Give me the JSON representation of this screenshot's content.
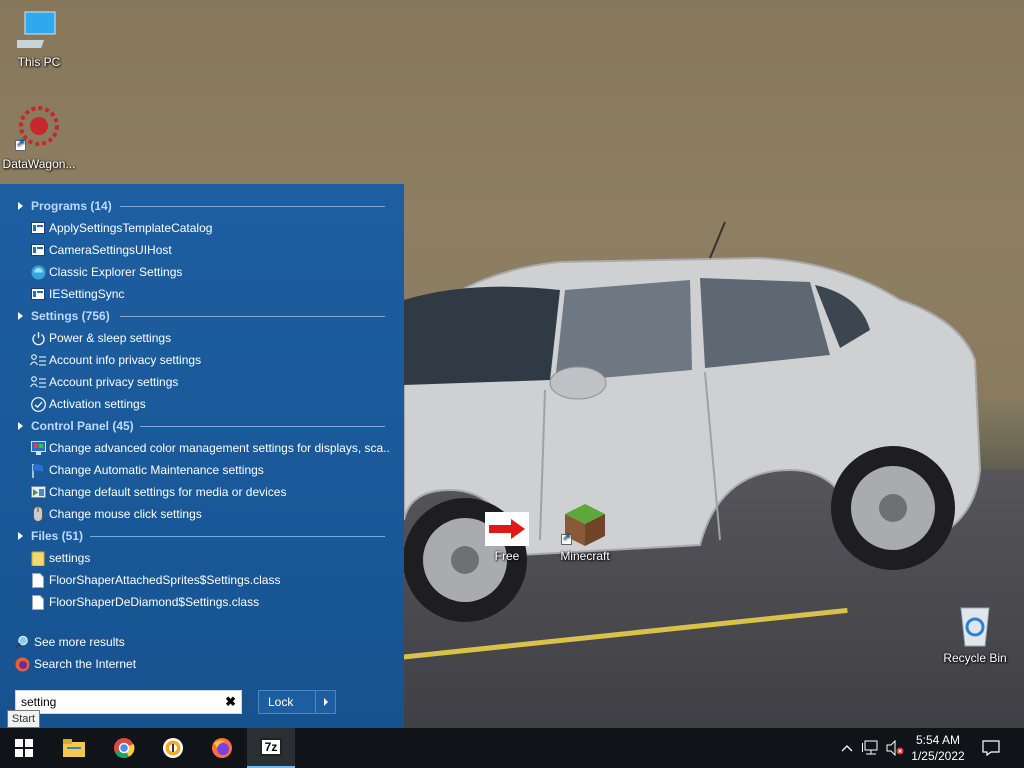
{
  "desktop": {
    "icons": [
      {
        "label": "This PC",
        "icon": "computer-icon"
      },
      {
        "label": "DataWagon...",
        "icon": "datawagon-icon"
      },
      {
        "label": "Free",
        "icon": "red-arrow-icon"
      },
      {
        "label": "Minecraft",
        "icon": "minecraft-icon"
      },
      {
        "label": "Recycle Bin",
        "icon": "recycle-bin-icon"
      }
    ]
  },
  "start_menu": {
    "groups": {
      "programs": "Programs (14)",
      "settings": "Settings (756)",
      "control_panel": "Control Panel (45)",
      "files": "Files (51)"
    },
    "programs": [
      "ApplySettingsTemplateCatalog",
      "CameraSettingsUIHost",
      "Classic Explorer Settings",
      "IESettingSync"
    ],
    "settings": [
      "Power & sleep settings",
      "Account info privacy settings",
      "Account privacy settings",
      "Activation settings"
    ],
    "control_panel": [
      "Change advanced color management settings for displays, sca...",
      "Change Automatic Maintenance settings",
      "Change default settings for media or devices",
      "Change mouse click settings"
    ],
    "files": [
      "settings",
      "FloorShaperAttachedSprites$Settings.class",
      "FloorShaperDeDiamond$Settings.class"
    ],
    "see_more": "See more results",
    "search_internet": "Search the Internet",
    "search_value": "setting",
    "lock_label": "Lock"
  },
  "tooltip": "Start",
  "taskbar": {
    "time": "5:54 AM",
    "date": "1/25/2022",
    "apps": [
      "chrome-icon",
      "brave-icon",
      "firefox-icon",
      "7zip-icon"
    ]
  },
  "colors": {
    "menu_bg": "#1d5ea0",
    "group_text": "#bcd9ff",
    "taskbar_bg": "#101418"
  }
}
